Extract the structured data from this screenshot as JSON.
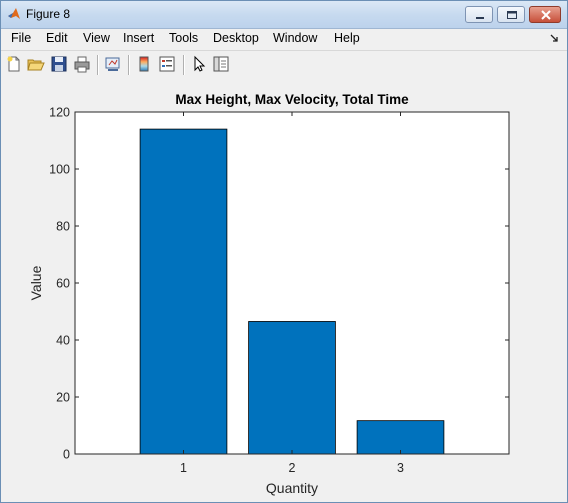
{
  "window": {
    "title": "Figure 8"
  },
  "menu": {
    "items": [
      "File",
      "Edit",
      "View",
      "Insert",
      "Tools",
      "Desktop",
      "Window",
      "Help"
    ]
  },
  "toolbar": {
    "buttons": [
      "new-figure-icon",
      "open-file-icon",
      "save-icon",
      "print-icon",
      "link-plot-icon",
      "insert-colorbar-icon",
      "insert-legend-icon",
      "pointer-icon",
      "show-plot-tools-icon"
    ]
  },
  "chart_data": {
    "type": "bar",
    "title": "Max Height, Max Velocity, Total Time",
    "xlabel": "Quantity",
    "ylabel": "Value",
    "categories": [
      "1",
      "2",
      "3"
    ],
    "values": [
      114,
      46.5,
      11.7
    ],
    "ylim": [
      0,
      120
    ],
    "yticks": [
      "0",
      "20",
      "40",
      "60",
      "80",
      "100",
      "120"
    ],
    "grid": false,
    "bar_color": "#0072bd"
  }
}
